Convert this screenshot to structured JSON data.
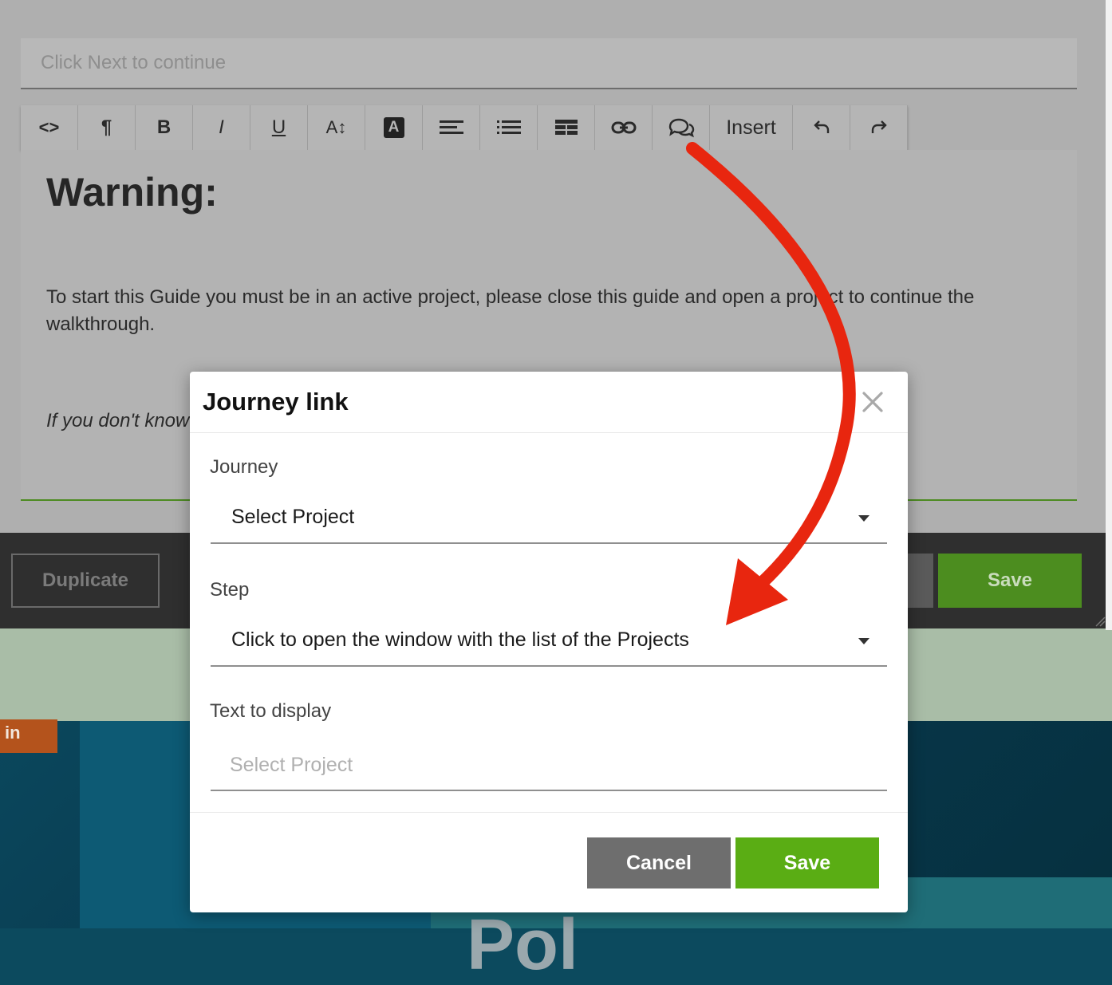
{
  "background": {
    "side_tab_label": "in",
    "partial_heading": "Pol"
  },
  "editor": {
    "title_placeholder": "Click Next to continue",
    "toolbar": {
      "buttons": [
        {
          "icon": "code-view-icon",
          "glyph": "<>"
        },
        {
          "icon": "paragraph-icon",
          "glyph": "¶"
        },
        {
          "icon": "bold-icon",
          "glyph": "B"
        },
        {
          "icon": "italic-icon",
          "glyph": "I"
        },
        {
          "icon": "underline-icon",
          "glyph": "U"
        },
        {
          "icon": "font-size-icon",
          "glyph": "A↕"
        },
        {
          "icon": "font-color-icon",
          "glyph": "A"
        },
        {
          "icon": "align-icon"
        },
        {
          "icon": "list-icon"
        },
        {
          "icon": "table-icon"
        },
        {
          "icon": "link-icon"
        },
        {
          "icon": "journey-link-icon"
        }
      ],
      "insert_label": "Insert",
      "undo_icon": "undo-icon",
      "redo_icon": "redo-icon"
    },
    "content": {
      "heading": "Warning:",
      "paragraph": "To start this Guide you must be in an active project, please close this guide and open a project to continue the walkthrough.",
      "italic_line": "If you don't know"
    },
    "bottom_bar": {
      "duplicate_label": "Duplicate",
      "save_label": "Save"
    }
  },
  "modal": {
    "title": "Journey link",
    "close_icon": "close-icon",
    "journey_label": "Journey",
    "journey_value": "Select Project",
    "step_label": "Step",
    "step_value": "Click to open the window with the list of the Projects",
    "text_label": "Text to display",
    "text_placeholder": "Select Project",
    "cancel_label": "Cancel",
    "save_label": "Save"
  },
  "colors": {
    "save_green": "#5aad14",
    "cancel_gray": "#6e6e6e",
    "annotation_arrow": "#e8260f"
  }
}
